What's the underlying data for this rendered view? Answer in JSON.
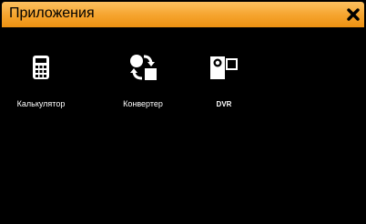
{
  "window": {
    "title": "Приложения",
    "close_icon": "close-icon",
    "titlebar_color": "#f5a32c",
    "background_color": "#000000"
  },
  "apps": [
    {
      "label": "Калькулятор",
      "icon": "calculator-icon"
    },
    {
      "label": "Конвертер",
      "icon": "converter-icon"
    },
    {
      "label": "DVR",
      "icon": "camera-icon"
    }
  ]
}
